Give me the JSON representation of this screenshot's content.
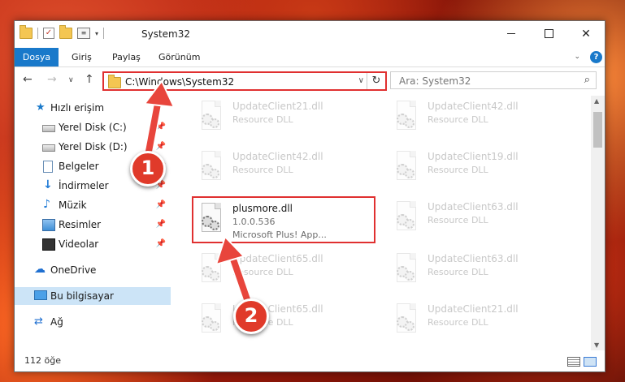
{
  "window": {
    "title": "System32",
    "check_glyph": "✓",
    "props_glyph": "≡",
    "caret_glyph": "▾",
    "close_glyph": "✕"
  },
  "ribbon": {
    "tabs": [
      "Dosya",
      "Giriş",
      "Paylaş",
      "Görünüm"
    ],
    "chevron": "⌄",
    "help": "?"
  },
  "nav": {
    "back": "←",
    "forward": "→",
    "recent": "∨",
    "up": "↑",
    "address": "C:\\Windows\\System32",
    "address_dropdown": "∨",
    "refresh": "↻",
    "search_placeholder": "Ara: System32",
    "search_glyph": "⌕"
  },
  "sidebar": {
    "items": [
      {
        "label": "Hızlı erişim",
        "icon": "star-icon",
        "glyph": "★"
      },
      {
        "label": "Yerel Disk (C:)",
        "icon": "disk-icon",
        "pin": "📌"
      },
      {
        "label": "Yerel Disk (D:)",
        "icon": "disk-icon",
        "pin": "📌"
      },
      {
        "label": "Belgeler",
        "icon": "document-icon",
        "pin": "📌"
      },
      {
        "label": "İndirmeler",
        "icon": "download-icon",
        "glyph": "↓",
        "pin": "📌"
      },
      {
        "label": "Müzik",
        "icon": "music-icon",
        "glyph": "♪",
        "pin": "📌"
      },
      {
        "label": "Resimler",
        "icon": "pictures-icon",
        "pin": "📌"
      },
      {
        "label": "Videolar",
        "icon": "video-icon",
        "pin": "📌"
      },
      {
        "label": "OneDrive",
        "icon": "cloud-icon",
        "glyph": "☁"
      },
      {
        "label": "Bu bilgisayar",
        "icon": "computer-icon"
      },
      {
        "label": "Ağ",
        "icon": "network-icon",
        "glyph": "⇄"
      }
    ]
  },
  "files": {
    "left": [
      {
        "name": "UpdateClient21.dll",
        "type": "Resource DLL"
      },
      {
        "name": "UpdateClient42.dll",
        "type": "Resource DLL"
      },
      {
        "name": "plusmore.dll",
        "version": "1.0.0.536",
        "desc": "Microsoft Plus! App..."
      },
      {
        "name": "UpdateClient65.dll",
        "type": "Resource DLL"
      },
      {
        "name": "UpdateClient65.dll",
        "type": "Resource DLL"
      }
    ],
    "right": [
      {
        "name": "UpdateClient42.dll",
        "type": "Resource DLL"
      },
      {
        "name": "UpdateClient19.dll",
        "type": "Resource DLL"
      },
      {
        "name": "UpdateClient63.dll",
        "type": "Resource DLL"
      },
      {
        "name": "UpdateClient63.dll",
        "type": "Resource DLL"
      },
      {
        "name": "UpdateClient21.dll",
        "type": "Resource DLL"
      }
    ]
  },
  "scroll": {
    "up": "▲",
    "down": "▼"
  },
  "status": {
    "count": "112 öğe"
  },
  "annotations": {
    "badge1": "1",
    "badge2": "2"
  },
  "colors": {
    "accent": "#1979ca",
    "highlight": "#e03030",
    "badge": "#e03a2a",
    "arrow": "#e8453c"
  }
}
